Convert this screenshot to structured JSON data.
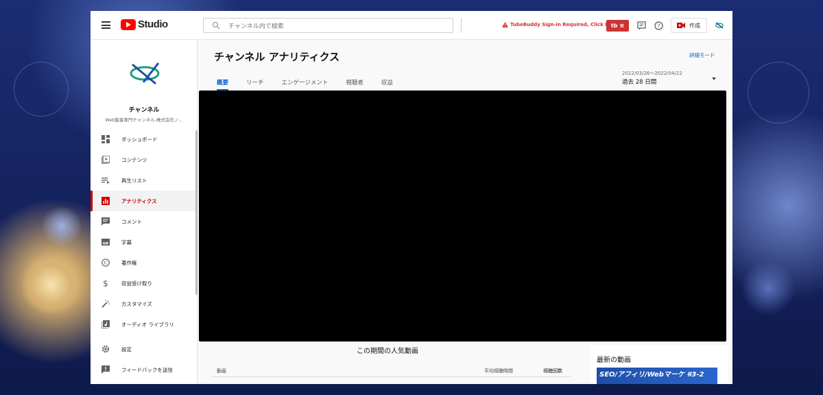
{
  "app": {
    "logo_text": "Studio"
  },
  "search": {
    "placeholder": "チャンネル内で検索"
  },
  "topbar": {
    "tubebuddy_warning": "TubeBuddy Sign-in Required, Click Here",
    "tubebuddy_button": "tb",
    "create_label": "作成"
  },
  "channel": {
    "name": "チャンネル",
    "subtitle": "Web集客専門チャンネル-株式会社ノ..."
  },
  "sidebar": {
    "items": [
      {
        "label": "ダッシュボード",
        "icon": "dashboard-icon"
      },
      {
        "label": "コンテンツ",
        "icon": "content-icon"
      },
      {
        "label": "再生リスト",
        "icon": "playlist-icon"
      },
      {
        "label": "アナリティクス",
        "icon": "analytics-icon",
        "active": true
      },
      {
        "label": "コメント",
        "icon": "comment-icon"
      },
      {
        "label": "字幕",
        "icon": "subtitles-icon"
      },
      {
        "label": "著作権",
        "icon": "copyright-icon"
      },
      {
        "label": "収益受け取り",
        "icon": "dollar-icon"
      },
      {
        "label": "カスタマイズ",
        "icon": "magic-wand-icon"
      },
      {
        "label": "オーディオ ライブラリ",
        "icon": "audio-library-icon"
      },
      {
        "label": "設定",
        "icon": "gear-icon"
      },
      {
        "label": "フィードバックを送信",
        "icon": "feedback-icon"
      }
    ]
  },
  "main": {
    "title": "チャンネル アナリティクス",
    "advanced_mode": "詳細モード",
    "tabs": [
      "概要",
      "リーチ",
      "エンゲージメント",
      "視聴者",
      "収益"
    ],
    "date_range": "2022/03/26～2022/04/22",
    "date_label": "過去 28 日間",
    "popular_title": "この期間の人気動画",
    "table_headers": {
      "video": "動画",
      "avg": "平均視聴時間",
      "views": "視聴回数"
    },
    "latest_title": "最新の動画",
    "latest_thumb_text": "SEO/アフィリ/Webマーケ #3-2"
  },
  "colors": {
    "accent": "#065fd4",
    "active": "#cc0000",
    "brand_red": "#ff0000"
  }
}
